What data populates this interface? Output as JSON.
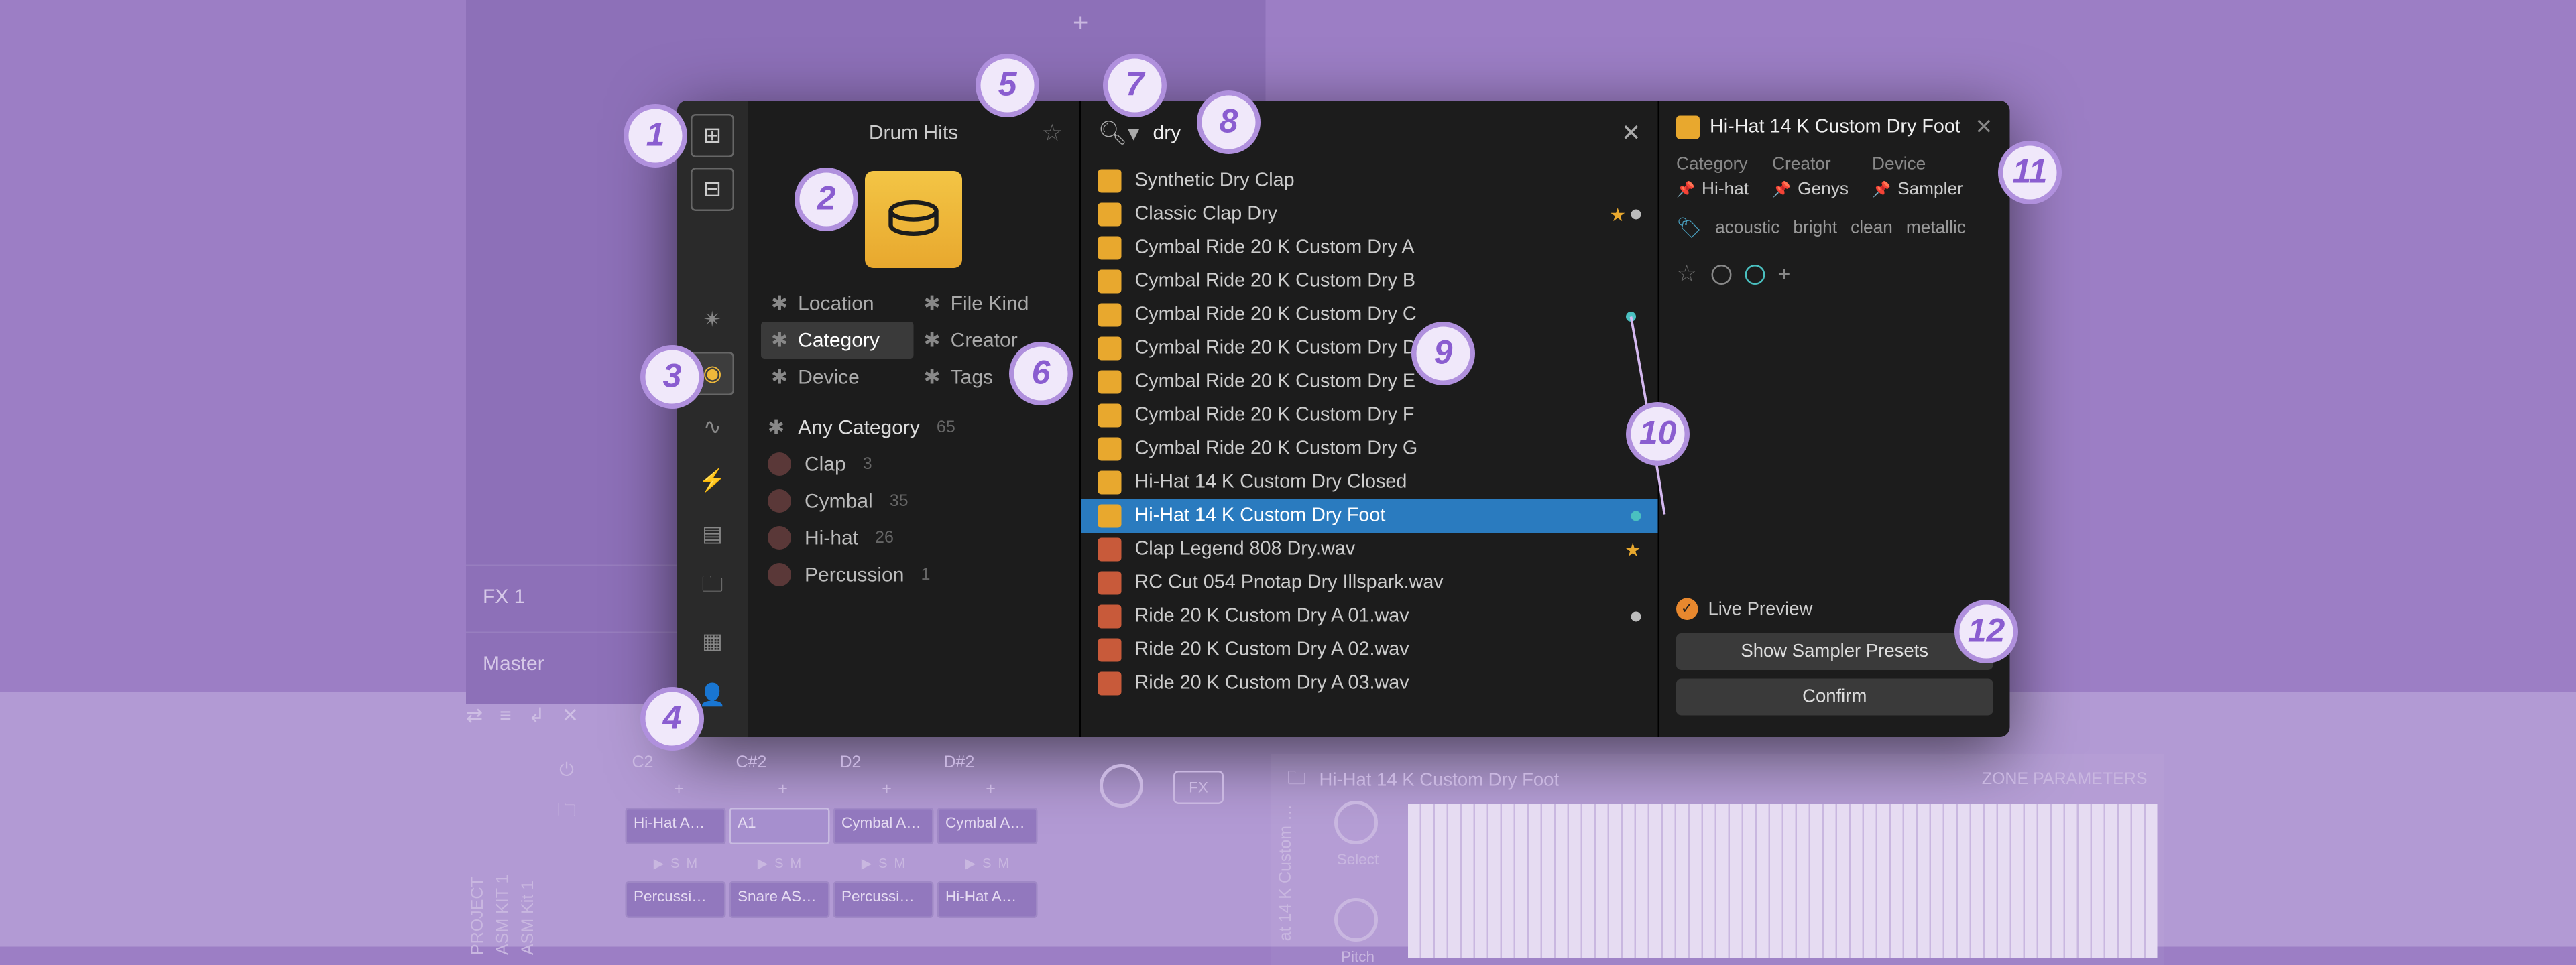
{
  "badges": [
    "1",
    "2",
    "3",
    "4",
    "5",
    "6",
    "7",
    "8",
    "9",
    "10",
    "11",
    "12"
  ],
  "tracks": {
    "fx1": "FX 1",
    "master": "Master"
  },
  "browser": {
    "title": "Drum Hits",
    "search_value": "dry",
    "filters": {
      "location": "Location",
      "filekind": "File Kind",
      "category": "Category",
      "creator": "Creator",
      "device": "Device",
      "tags": "Tags"
    },
    "any_category": "Any Category",
    "any_category_count": "65",
    "categories": [
      {
        "name": "Clap",
        "count": "3"
      },
      {
        "name": "Cymbal",
        "count": "35"
      },
      {
        "name": "Hi-hat",
        "count": "26"
      },
      {
        "name": "Percussion",
        "count": "1"
      }
    ],
    "results": [
      {
        "name": "Synthetic Dry Clap",
        "kind": "preset"
      },
      {
        "name": "Classic Clap Dry",
        "kind": "preset",
        "star": true,
        "white": true
      },
      {
        "name": "Cymbal Ride 20 K Custom Dry A",
        "kind": "preset"
      },
      {
        "name": "Cymbal Ride 20 K Custom Dry B",
        "kind": "preset"
      },
      {
        "name": "Cymbal Ride 20 K Custom Dry C",
        "kind": "preset"
      },
      {
        "name": "Cymbal Ride 20 K Custom Dry D",
        "kind": "preset"
      },
      {
        "name": "Cymbal Ride 20 K Custom Dry E",
        "kind": "preset"
      },
      {
        "name": "Cymbal Ride 20 K Custom Dry F",
        "kind": "preset"
      },
      {
        "name": "Cymbal Ride 20 K Custom Dry G",
        "kind": "preset"
      },
      {
        "name": "Hi-Hat 14 K Custom Dry Closed",
        "kind": "preset"
      },
      {
        "name": "Hi-Hat 14 K Custom Dry Foot",
        "kind": "preset",
        "selected": true,
        "cyan": true
      },
      {
        "name": "Clap Legend 808 Dry.wav",
        "kind": "wav",
        "star": true
      },
      {
        "name": "RC Cut 054 Pnotap Dry Illspark.wav",
        "kind": "wav"
      },
      {
        "name": "Ride 20 K Custom Dry A 01.wav",
        "kind": "wav",
        "white": true
      },
      {
        "name": "Ride 20 K Custom Dry A 02.wav",
        "kind": "wav"
      },
      {
        "name": "Ride 20 K Custom Dry A 03.wav",
        "kind": "wav"
      }
    ],
    "detail": {
      "title": "Hi-Hat 14 K Custom Dry Foot",
      "meta_headers": {
        "category": "Category",
        "creator": "Creator",
        "device": "Device"
      },
      "meta_values": {
        "category": "Hi-hat",
        "creator": "Genys",
        "device": "Sampler"
      },
      "tags": [
        "acoustic",
        "bright",
        "clean",
        "metallic"
      ],
      "live_preview": "Live Preview",
      "show_presets": "Show Sampler Presets",
      "confirm": "Confirm"
    }
  },
  "lower": {
    "vert_labels": [
      "PROJECT",
      "ASM KIT 1",
      "ASM Kit 1"
    ],
    "pad_headers": [
      "C2",
      "C#2",
      "D2",
      "D#2"
    ],
    "pad_names": [
      [
        "Hi-Hat A…",
        "A1",
        "Cymbal A…",
        "Cymbal A…"
      ],
      [
        "Percussi…",
        "Snare AS…",
        "Percussi…",
        "Hi-Hat A…"
      ]
    ],
    "fx_label": "FX",
    "zone_title": "Hi-Hat 14 K Custom Dry Foot",
    "zone_params": "ZONE PARAMETERS",
    "knob_labels": {
      "select": "Select",
      "pitch": "Pitch"
    },
    "vert_foot": "at 14 K Custom …"
  }
}
